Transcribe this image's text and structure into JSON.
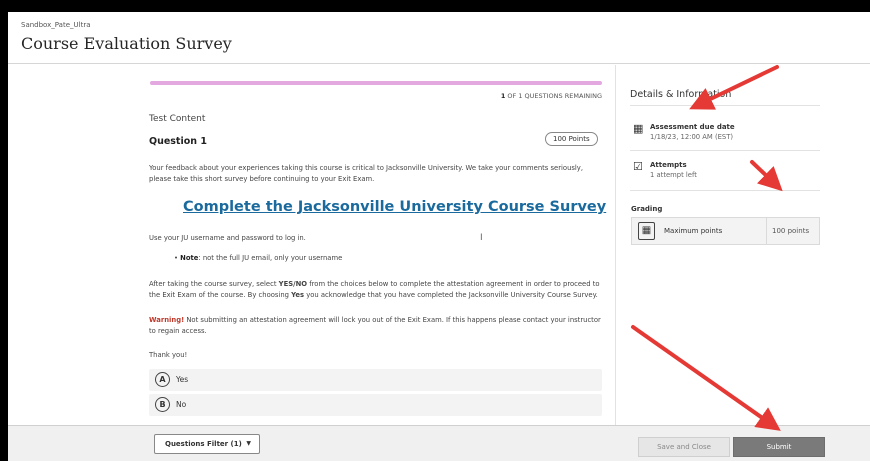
{
  "header": {
    "breadcrumb": "Sandbox_Pate_Ultra",
    "title": "Course Evaluation Survey"
  },
  "progress": {
    "count": "1",
    "remaining_text": " OF 1 QUESTIONS REMAINING",
    "fraction_complete": 1.0
  },
  "question": {
    "section_label": "Test Content",
    "title": "Question 1",
    "points": "100 Points",
    "intro": "Your feedback about your experiences taking this course is critical to Jacksonville University. We take your comments seriously, please take this short survey before continuing to your Exit Exam.",
    "survey_link": "Complete the Jacksonville University Course Survey",
    "login_text": "Use your JU username and password to log in.",
    "note_label": "Note",
    "note_text": ": not the full JU email, only your username",
    "attest_1": "After taking the course survey, select ",
    "attest_bold_1": "YES/NO",
    "attest_2": " from the choices below to complete the attestation agreement in order to proceed to the Exit Exam of the course. By choosing ",
    "attest_bold_2": "Yes",
    "attest_3": " you acknowledge that you have completed the Jacksonville University Course Survey.",
    "warning_label": "Warning!",
    "warning_text": " Not submitting an attestation agreement will lock you out of the Exit Exam. If this happens please contact your instructor to regain access.",
    "thanks": "Thank you!",
    "choices": [
      {
        "letter": "A",
        "label": "Yes"
      },
      {
        "letter": "B",
        "label": "No"
      }
    ]
  },
  "sidebar": {
    "title": "Details & Information",
    "due_label": "Assessment due date",
    "due_value": "1/18/23, 12:00 AM (EST)",
    "attempts_label": "Attempts",
    "attempts_value": "1 attempt left",
    "grading_label": "Grading",
    "max_points_label": "Maximum points",
    "max_points_value": "100 points"
  },
  "footer": {
    "filter_label": "Questions Filter (1)",
    "save_label": "Save and Close",
    "submit_label": "Submit"
  },
  "colors": {
    "progress": "#e3a8e0",
    "link": "#1a6a9e",
    "warning": "#c0392b",
    "arrow": "#e53935",
    "submit_bg": "#7a7a7a"
  },
  "icons": [
    "calendar-icon",
    "checkbox-icon",
    "calculator-icon",
    "caret-down-icon",
    "text-cursor-icon"
  ]
}
